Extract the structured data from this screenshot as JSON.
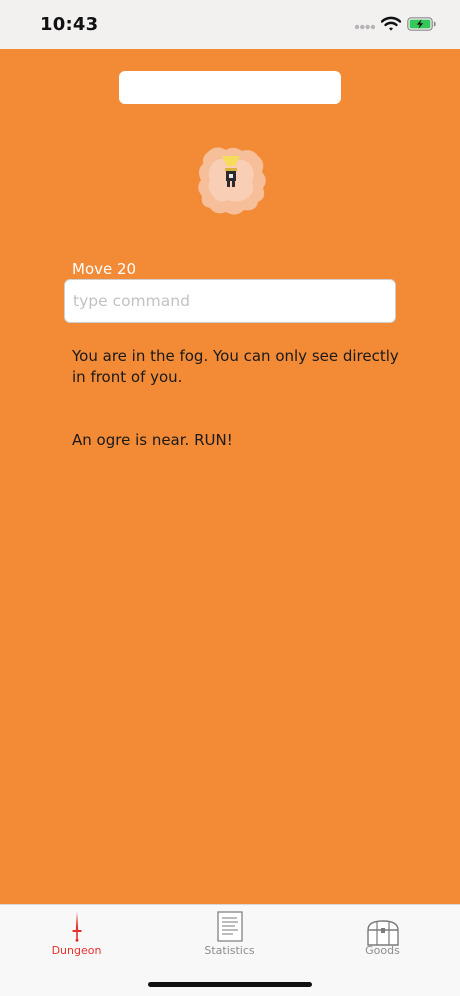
{
  "status_bar": {
    "time": "10:43",
    "icons": [
      "signal-dots-icon",
      "wifi-icon",
      "battery-charging-icon"
    ]
  },
  "main": {
    "background": "#f28a36",
    "map_image": "fog-map-player-icon",
    "move_label": "Move 20",
    "command_input": {
      "value": "",
      "placeholder": "type command"
    },
    "messages": [
      "You are in the fog. You can only see directly in front of you.",
      "An ogre is near. RUN!"
    ]
  },
  "tab_bar": {
    "tabs": [
      {
        "label": "Dungeon",
        "icon": "sword-icon",
        "active": true
      },
      {
        "label": "Statistics",
        "icon": "document-icon",
        "active": false
      },
      {
        "label": "Goods",
        "icon": "chest-icon",
        "active": false
      }
    ],
    "active_color": "#e5312c",
    "inactive_color": "#8e8e8e"
  }
}
